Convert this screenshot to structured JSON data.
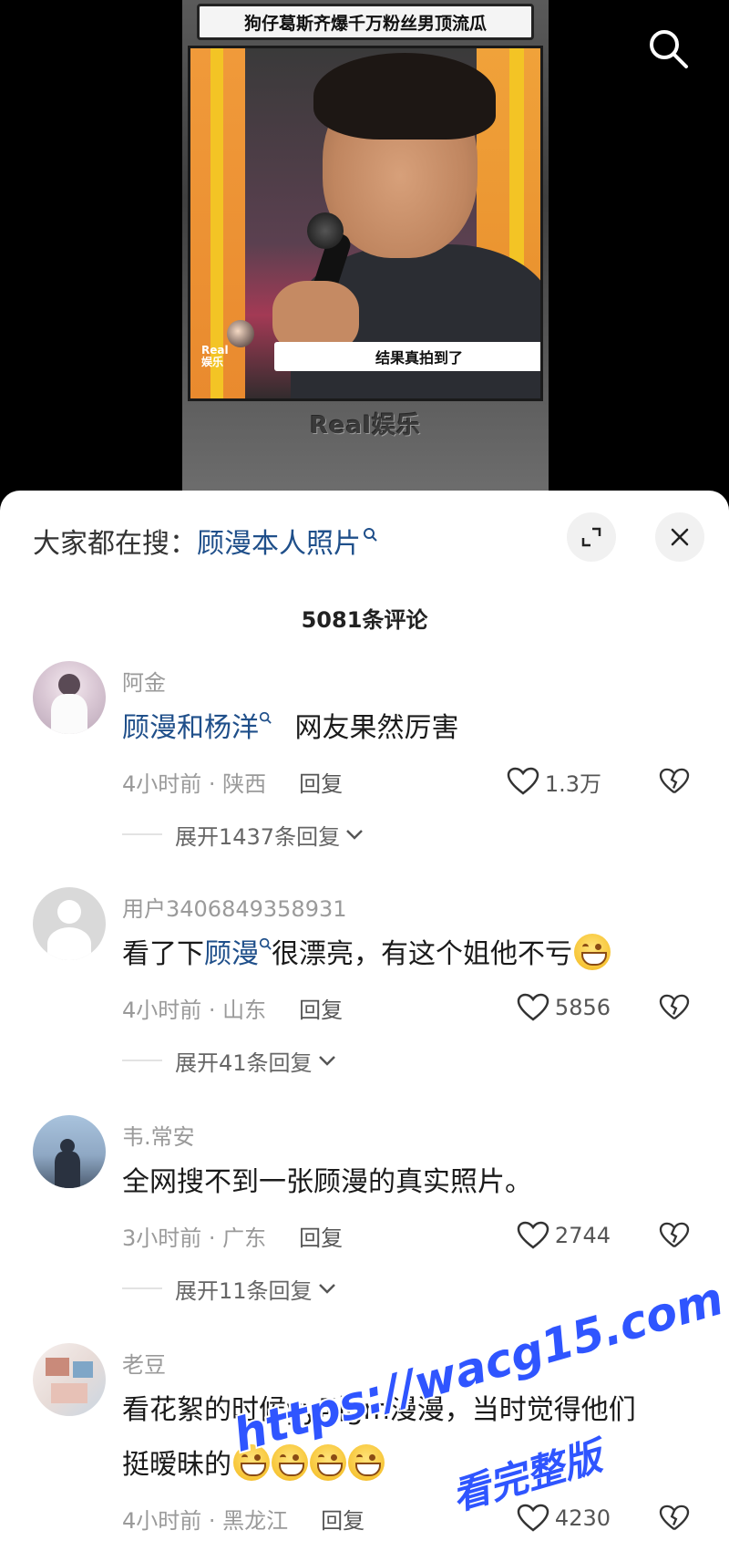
{
  "video": {
    "title": "狗仔葛斯齐爆千万粉丝男顶流瓜",
    "subtitle": "结果真拍到了",
    "brand": "Real娱乐",
    "corner_logo_line1": "Real",
    "corner_logo_line2": "娱乐"
  },
  "top_icons": {
    "search": "search-icon"
  },
  "panel": {
    "search_prefix": "大家都在搜：",
    "search_term": "顾漫本人照片",
    "comment_count": "5081条评论"
  },
  "comments": [
    {
      "user": "阿金",
      "text_hl": "顾漫和杨洋",
      "text_after": "网友果然厉害",
      "time": "4小时前 · 陕西",
      "reply": "回复",
      "likes": "1.3万",
      "expand": "展开1437条回复"
    },
    {
      "user": "用户3406849358931",
      "text_before": "看了下",
      "text_hl": "顾漫",
      "text_after": "很漂亮，有这个姐他不亏",
      "time": "4小时前 · 山东",
      "reply": "回复",
      "likes": "5856",
      "expand": "展开41条回复"
    },
    {
      "user": "韦.常安",
      "text": "全网搜不到一张顾漫的真实照片。",
      "time": "3小时前 · 广东",
      "reply": "回复",
      "likes": "2744",
      "expand": "展开11条回复"
    },
    {
      "user": "老豆",
      "text_line1": "看花絮的时候yy叫gm漫漫，当时觉得他们",
      "text_line2": "挺暧昧的",
      "time": "4小时前 · 黑龙江",
      "reply": "回复",
      "likes": "4230"
    }
  ],
  "watermark": {
    "url": "https://wacg15.com",
    "sub": "看完整版"
  },
  "colors": {
    "link": "#1f4f8a",
    "watermark": "#2f55ff",
    "meta": "#9a9a9a"
  }
}
